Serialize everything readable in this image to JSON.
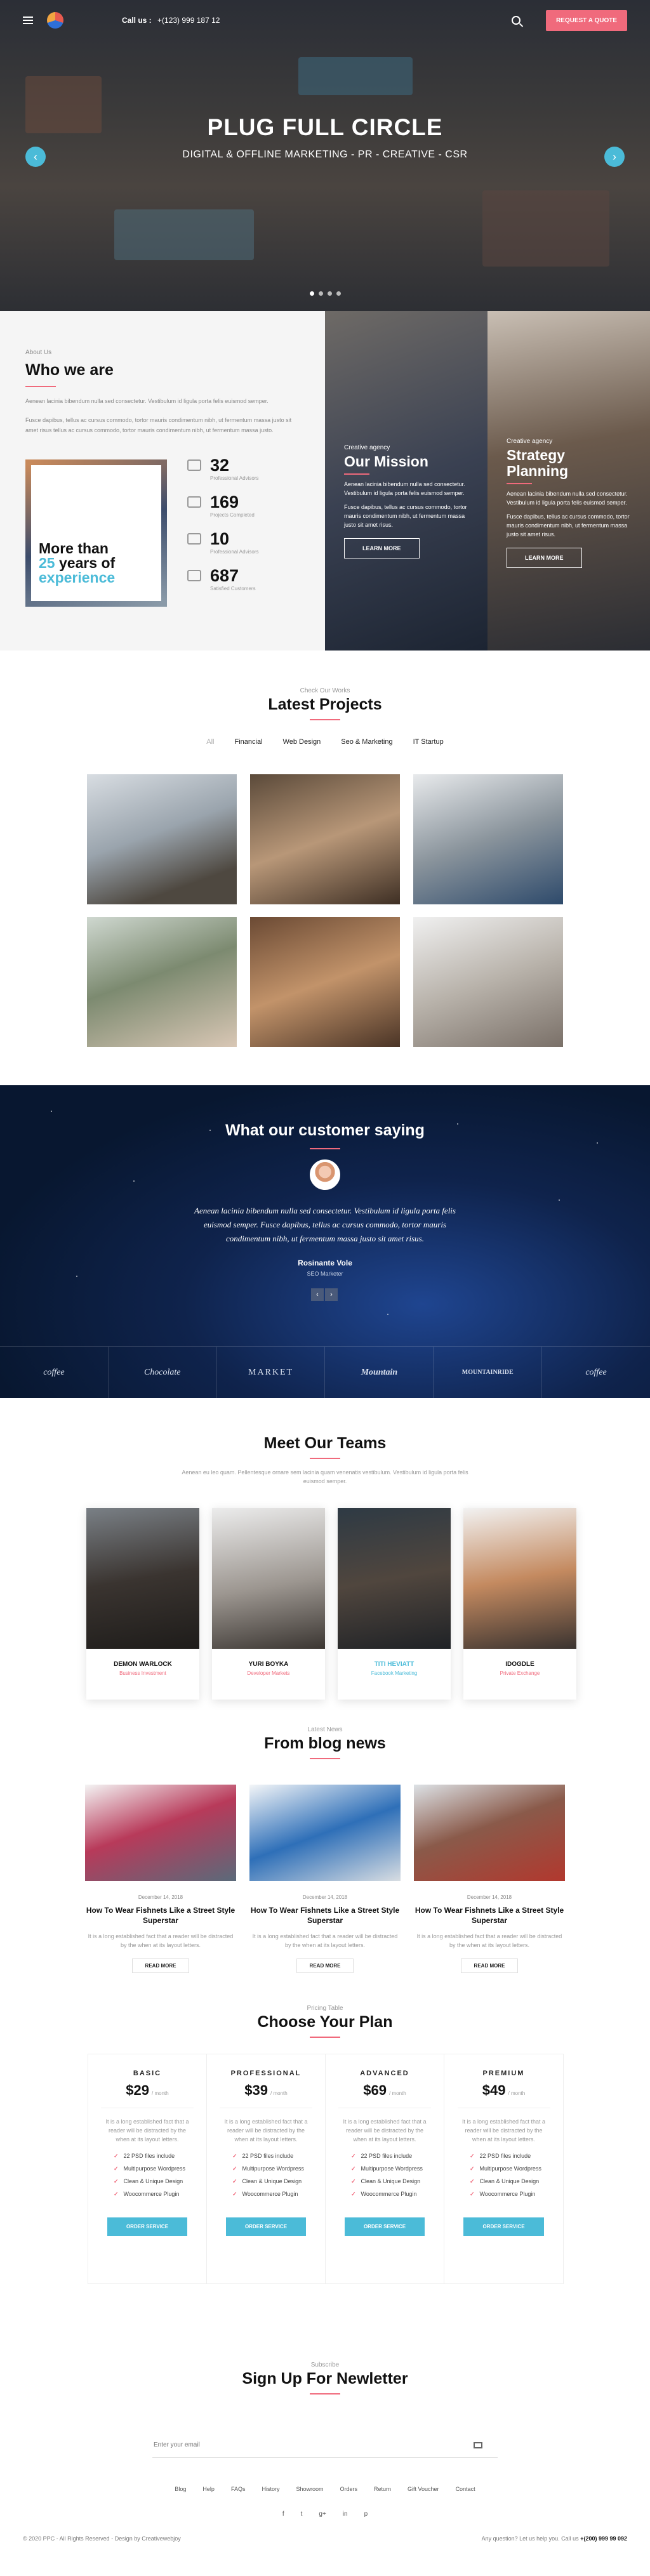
{
  "header": {
    "call_label": "Call us :",
    "phone": "+(123) 999 187 12",
    "quote_button": "REQUEST A QUOTE"
  },
  "hero": {
    "title": "PLUG FULL CIRCLE",
    "subtitle": "DIGITAL & OFFLINE MARKETING - PR - CREATIVE - CSR",
    "prev": "‹",
    "next": "›"
  },
  "about": {
    "eyebrow": "About Us",
    "title": "Who we are",
    "p1": "Aenean lacinia bibendum nulla sed consectetur. Vestibulum id ligula porta felis euismod semper.",
    "p2": "Fusce dapibus, tellus ac cursus commodo, tortor mauris condimentum nibh, ut fermentum massa justo sit amet risus tellus ac cursus commodo, tortor mauris condimentum nibh, ut fermentum massa justo.",
    "exp_line1": "More than",
    "exp_years": "25",
    "exp_line2": "years of",
    "exp_line3": "experience",
    "stats": [
      {
        "value": "32",
        "label": "Professional Advisors"
      },
      {
        "value": "169",
        "label": "Projects Completed"
      },
      {
        "value": "10",
        "label": "Professional Advisors"
      },
      {
        "value": "687",
        "label": "Satisfied Customers"
      }
    ],
    "cards": [
      {
        "eyebrow": "Creative agency",
        "title": "Our Mission",
        "p1": "Aenean lacinia bibendum nulla sed consectetur. Vestibulum id ligula porta felis euismod semper.",
        "p2": "Fusce dapibus, tellus ac cursus commodo, tortor mauris condimentum nibh, ut fermentum massa justo sit amet risus.",
        "button": "LEARN MORE"
      },
      {
        "eyebrow": "Creative agency",
        "title_line1": "Strategy",
        "title_line2": "Planning",
        "p1": "Aenean lacinia bibendum nulla sed consectetur. Vestibulum id ligula porta felis euismod semper.",
        "p2": "Fusce dapibus, tellus ac cursus commodo, tortor mauris condimentum nibh, ut fermentum massa justo sit amet risus.",
        "button": "LEARN MORE"
      }
    ]
  },
  "projects": {
    "eyebrow": "Check Our Works",
    "title": "Latest Projects",
    "filters": [
      "All",
      "Financial",
      "Web Design",
      "Seo & Marketing",
      "IT Startup"
    ]
  },
  "testimonial": {
    "title": "What our customer saying",
    "quote": "Aenean lacinia bibendum nulla sed consectetur. Vestibulum id ligula porta felis euismod semper. Fusce dapibus, tellus ac cursus commodo, tortor mauris condimentum nibh, ut fermentum massa justo sit amet risus.",
    "name": "Rosinante Vole",
    "role": "SEO Marketer",
    "prev": "‹",
    "next": "›",
    "brands": [
      "coffee",
      "Chocolate",
      "MARKET",
      "Mountain",
      "MOUNTAINRIDE",
      "coffee"
    ]
  },
  "team": {
    "title": "Meet Our Teams",
    "intro": "Aenean eu leo quam. Pellentesque ornare sem lacinia quam venenatis vestibulum. Vestibulum id ligula porta felis euismod semper.",
    "members": [
      {
        "name": "DEMON WARLOCK",
        "role": "Business Investment"
      },
      {
        "name": "YURI BOYKA",
        "role": "Developer Markets"
      },
      {
        "name": "TITI HEVIATT",
        "role": "Facebook Marketing"
      },
      {
        "name": "IDOGDLE",
        "role": "Private Exchange"
      }
    ]
  },
  "blog": {
    "eyebrow": "Latest News",
    "title": "From blog news",
    "posts": [
      {
        "date": "December 14, 2018",
        "title": "How To Wear Fishnets Like a Street Style Superstar",
        "text": "It is a long established fact that a reader will be distracted by the when at its layout letters.",
        "button": "READ MORE"
      },
      {
        "date": "December 14, 2018",
        "title": "How To Wear Fishnets Like a Street Style Superstar",
        "text": "It is a long established fact that a reader will be distracted by the when at its layout letters.",
        "button": "READ MORE"
      },
      {
        "date": "December 14, 2018",
        "title": "How To Wear Fishnets Like a Street Style Superstar",
        "text": "It is a long established fact that a reader will be distracted by the when at its layout letters.",
        "button": "READ MORE"
      }
    ]
  },
  "pricing": {
    "eyebrow": "Pricing Table",
    "title": "Choose Your Plan",
    "per": "/ month",
    "plans": [
      {
        "name": "BASIC",
        "price": "$29",
        "desc": "It is a long established fact that a reader will be distracted by the when at its layout letters.",
        "features": [
          "22 PSD files include",
          "Multipurpose Wordpress",
          "Clean & Unique Design",
          "Woocommerce Plugin"
        ],
        "button": "ORDER SERVICE"
      },
      {
        "name": "PROFESSIONAL",
        "price": "$39",
        "desc": "It is a long established fact that a reader will be distracted by the when at its layout letters.",
        "features": [
          "22 PSD files include",
          "Multipurpose Wordpress",
          "Clean & Unique Design",
          "Woocommerce Plugin"
        ],
        "button": "ORDER SERVICE"
      },
      {
        "name": "ADVANCED",
        "price": "$69",
        "desc": "It is a long established fact that a reader will be distracted by the when at its layout letters.",
        "features": [
          "22 PSD files include",
          "Multipurpose Wordpress",
          "Clean & Unique Design",
          "Woocommerce Plugin"
        ],
        "button": "ORDER SERVICE"
      },
      {
        "name": "PREMIUM",
        "price": "$49",
        "desc": "It is a long established fact that a reader will be distracted by the when at its layout letters.",
        "features": [
          "22 PSD files include",
          "Multipurpose Wordpress",
          "Clean & Unique Design",
          "Woocommerce Plugin"
        ],
        "button": "ORDER SERVICE"
      }
    ]
  },
  "newsletter": {
    "eyebrow": "Subscribe",
    "title": "Sign Up For Newletter",
    "placeholder": "Enter your email"
  },
  "footer": {
    "links": [
      "Blog",
      "Help",
      "FAQs",
      "History",
      "Showroom",
      "Orders",
      "Return",
      "Gift Voucher",
      "Contact"
    ],
    "social": [
      "f",
      "t",
      "g+",
      "in",
      "p"
    ],
    "copyright": "© 2020 PPC - All Rights Reserved - Design by Creativewebjoy",
    "question": "Any question? Let us help you. Call us",
    "phone": "+(200) 999 99 092"
  }
}
